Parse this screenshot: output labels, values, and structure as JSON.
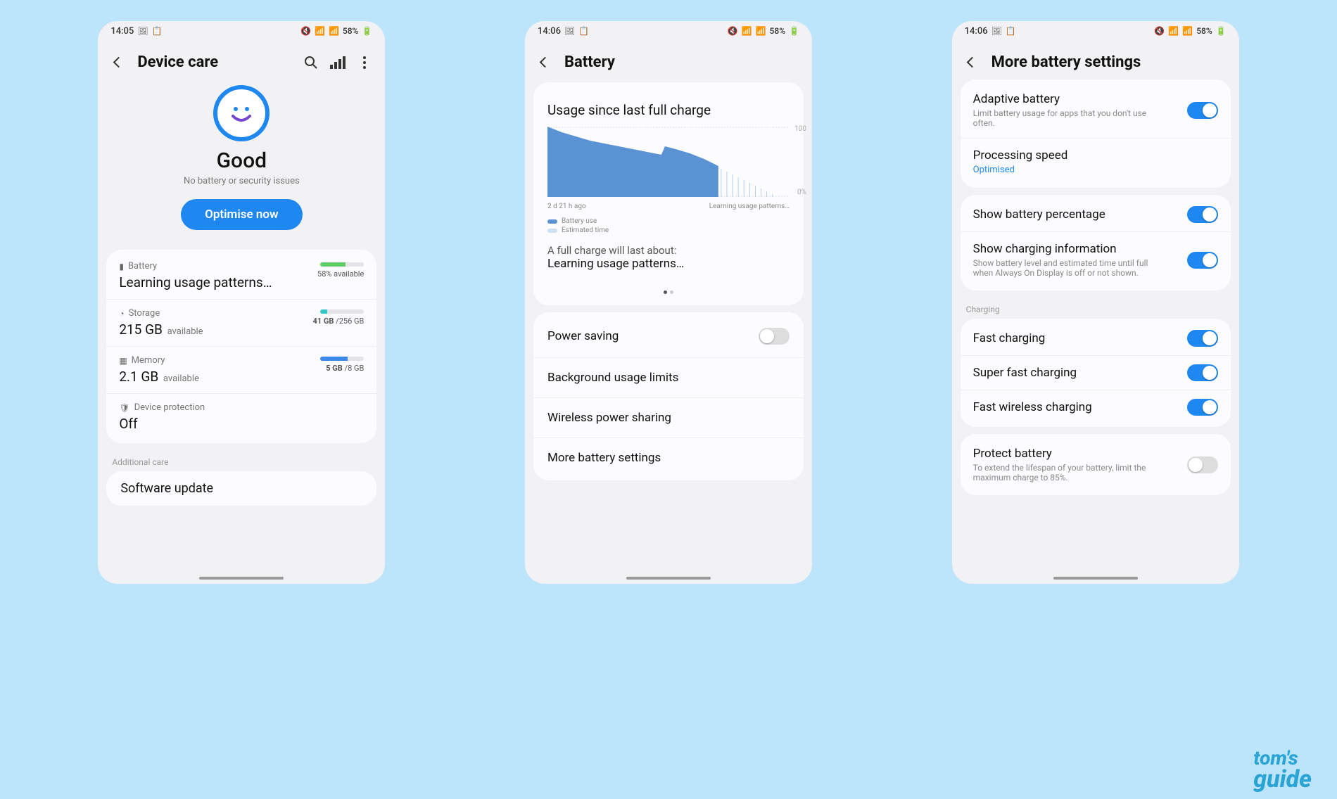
{
  "status": {
    "time1": "14:05",
    "time2": "14:06",
    "battery_text": "58%"
  },
  "screen1": {
    "title": "Device care",
    "hero_status": "Good",
    "hero_sub": "No battery or security issues",
    "optimise_btn": "Optimise now",
    "battery": {
      "label": "Battery",
      "value": "Learning usage patterns…",
      "meter_text": "58% available",
      "meter_pct": 58
    },
    "storage": {
      "label": "Storage",
      "value": "215 GB",
      "avail": "available",
      "used": "41 GB",
      "total": "256 GB",
      "meter_pct": 16
    },
    "memory": {
      "label": "Memory",
      "value": "2.1 GB",
      "avail": "available",
      "used": "5 GB",
      "total": "8 GB",
      "meter_pct": 62
    },
    "protection": {
      "label": "Device protection",
      "value": "Off"
    },
    "additional_hdr": "Additional care",
    "software_update": "Software update"
  },
  "screen2": {
    "title": "Battery",
    "usage_title": "Usage since last full charge",
    "xleft": "2 d 21 h ago",
    "xright": "Learning usage patterns…",
    "y_top": "100",
    "y_bottom": "0%",
    "legend_use": "Battery use",
    "legend_est": "Estimated time",
    "fc_label": "A full charge will last about:",
    "fc_value": "Learning usage patterns…",
    "rows": {
      "power_saving": "Power saving",
      "bg_limits": "Background usage limits",
      "wireless_share": "Wireless power sharing",
      "more": "More battery settings"
    },
    "chart_data": {
      "type": "area",
      "series": [
        {
          "name": "Battery use",
          "values": [
            100,
            95,
            90,
            86,
            82,
            80,
            78,
            75,
            72,
            70,
            68,
            65,
            62,
            60,
            72,
            70,
            67,
            64,
            60,
            56,
            52,
            48,
            44,
            40,
            36,
            32,
            28,
            24,
            20,
            16,
            12,
            8,
            4,
            0
          ]
        }
      ],
      "ylim": [
        0,
        100
      ],
      "xlabel": "2 d 21 h ago → now",
      "ylabel": "%"
    }
  },
  "screen3": {
    "title": "More battery settings",
    "adaptive": {
      "title": "Adaptive battery",
      "desc": "Limit battery usage for apps that you don't use often.",
      "on": true
    },
    "processing": {
      "title": "Processing speed",
      "value": "Optimised"
    },
    "show_pct": {
      "title": "Show battery percentage",
      "on": true
    },
    "show_charge": {
      "title": "Show charging information",
      "desc": "Show battery level and estimated time until full when Always On Display is off or not shown.",
      "on": true
    },
    "charging_hdr": "Charging",
    "fast": {
      "title": "Fast charging",
      "on": true
    },
    "superfast": {
      "title": "Super fast charging",
      "on": true
    },
    "fast_wireless": {
      "title": "Fast wireless charging",
      "on": true
    },
    "protect": {
      "title": "Protect battery",
      "desc": "To extend the lifespan of your battery, limit the maximum charge to 85%.",
      "on": false
    }
  },
  "watermark": {
    "line1": "tom's",
    "line2": "guide"
  }
}
